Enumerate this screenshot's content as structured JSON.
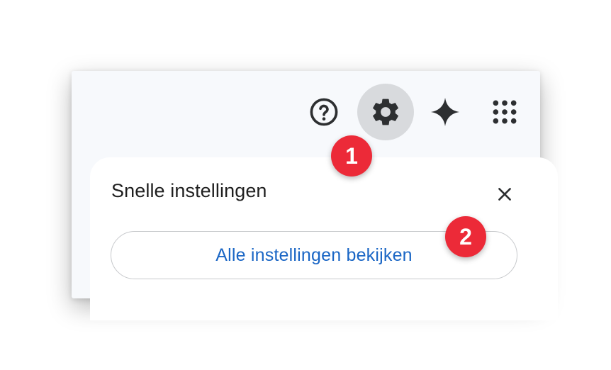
{
  "toolbar": {
    "help_icon": "help-circle-icon",
    "settings_icon": "gear-icon",
    "gemini_icon": "sparkle-icon",
    "apps_icon": "apps-grid-icon"
  },
  "quick_settings": {
    "title": "Snelle instellingen",
    "close_icon": "close-icon",
    "all_settings_label": "Alle instellingen bekijken"
  },
  "annotations": {
    "step1": "1",
    "step2": "2"
  },
  "colors": {
    "link_blue": "#1a66c5",
    "badge_red": "#ec2a38",
    "settings_active_bg": "#d8dadd",
    "surface": "#f7f9fc"
  }
}
